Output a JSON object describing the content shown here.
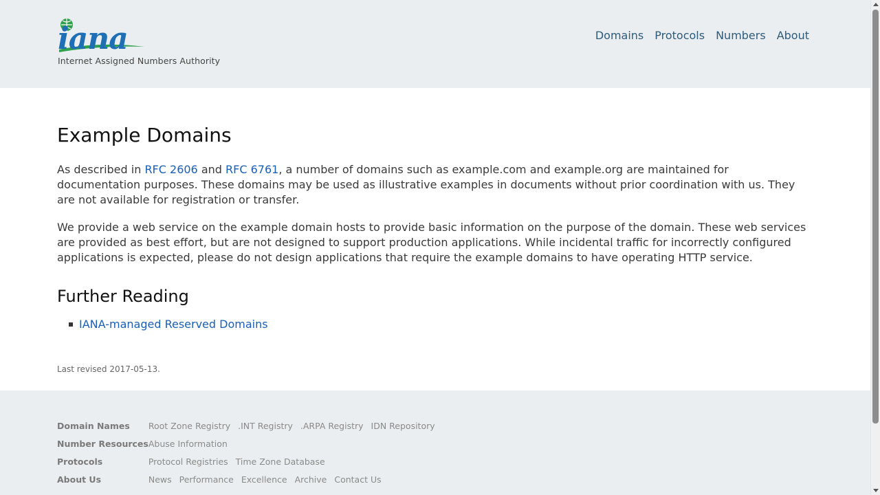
{
  "header": {
    "logo_text": "iana",
    "tagline": "Internet Assigned Numbers Authority",
    "nav": [
      {
        "label": "Domains"
      },
      {
        "label": "Protocols"
      },
      {
        "label": "Numbers"
      },
      {
        "label": "About"
      }
    ]
  },
  "main": {
    "title": "Example Domains",
    "p1": {
      "t1": "As described in ",
      "link1": "RFC 2606",
      "t2": " and ",
      "link2": "RFC 6761",
      "t3": ", a number of domains such as example.com and example.org are maintained for documentation purposes. These domains may be used as illustrative examples in documents without prior coordination with us. They are not available for registration or transfer."
    },
    "p2": "We provide a web service on the example domain hosts to provide basic information on the purpose of the domain. These web services are provided as best effort, but are not designed to support production applications. While incidental traffic for incorrectly configured applications is expected, please do not design applications that require the example domains to have operating HTTP service.",
    "further_reading_title": "Further Reading",
    "further_reading": [
      {
        "label": "IANA-managed Reserved Domains"
      }
    ],
    "last_revised": "Last revised 2017-05-13."
  },
  "footer": {
    "rows": [
      {
        "heading": "Domain Names",
        "links": [
          "Root Zone Registry",
          ".INT Registry",
          ".ARPA Registry",
          "IDN Repository"
        ]
      },
      {
        "heading": "Number Resources",
        "links": [
          "Abuse Information"
        ]
      },
      {
        "heading": "Protocols",
        "links": [
          "Protocol Registries",
          "Time Zone Database"
        ]
      },
      {
        "heading": "About Us",
        "links": [
          "News",
          "Performance",
          "Excellence",
          "Archive",
          "Contact Us"
        ]
      }
    ]
  },
  "colors": {
    "band_background": "#eaeef0",
    "nav_link": "#2c5b7c",
    "content_link": "#1a5fb4",
    "logo_blue": "#1f6fb6",
    "logo_green": "#2fa04c"
  }
}
